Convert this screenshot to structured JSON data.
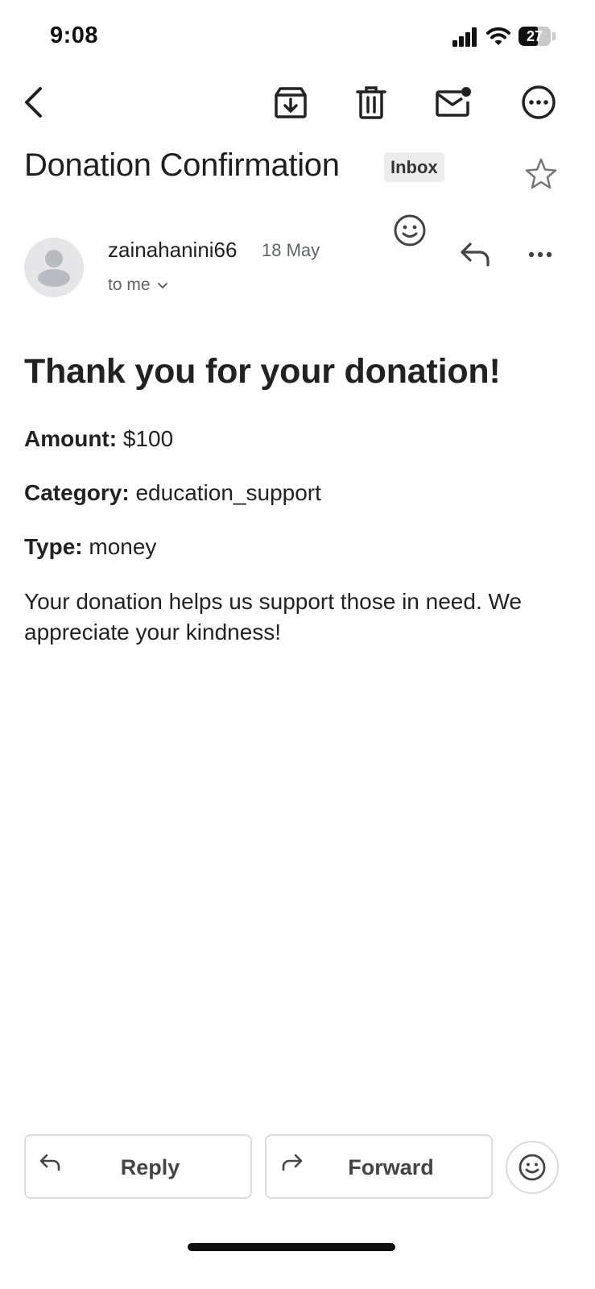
{
  "status_bar": {
    "time": "9:08",
    "battery_level": "27"
  },
  "toolbar": {
    "back": "back-icon",
    "archive": "archive-icon",
    "delete": "trash-icon",
    "mark_unread": "mail-unread-icon",
    "more": "more-options-icon"
  },
  "email": {
    "subject": "Donation Confirmation",
    "label": "Inbox",
    "starred": false,
    "sender": "zainahanini66",
    "date": "18 May",
    "recipient_line": "to me",
    "body": {
      "heading": "Thank you for your donation!",
      "fields": [
        {
          "label": "Amount:",
          "value": "$100"
        },
        {
          "label": "Category:",
          "value": "education_support"
        },
        {
          "label": "Type:",
          "value": "money"
        }
      ],
      "note": "Your donation helps us support those in need. We appreciate your kindness!"
    }
  },
  "actions": {
    "reply": "Reply",
    "forward": "Forward"
  },
  "colors": {
    "text": "#1f1f1f",
    "secondary": "#5f6368",
    "border": "#dadce0",
    "chip": "#ececec"
  }
}
